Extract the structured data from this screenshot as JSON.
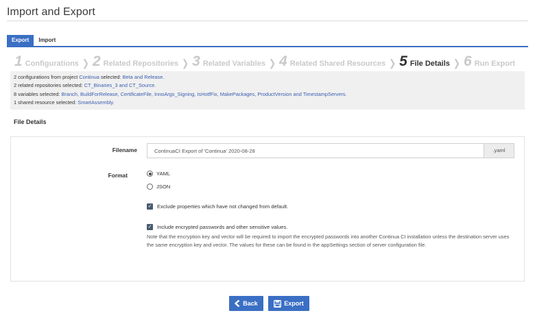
{
  "page": {
    "title": "Import and Export"
  },
  "tabs": [
    {
      "label": "Export",
      "active": true
    },
    {
      "label": "Import",
      "active": false
    }
  ],
  "steps": [
    {
      "num": "1",
      "label": "Configurations"
    },
    {
      "num": "2",
      "label": "Related Repositories"
    },
    {
      "num": "3",
      "label": "Related Variables"
    },
    {
      "num": "4",
      "label": "Related Shared Resources"
    },
    {
      "num": "5",
      "label": "File Details",
      "current": true
    },
    {
      "num": "6",
      "label": "Run Export"
    }
  ],
  "summary": {
    "line1": {
      "a": "2 configurations from project ",
      "project": "Continua",
      "b": " selected: ",
      "items": "Beta and Release."
    },
    "line2": {
      "a": "2 related repositories selected: ",
      "items": "CT_Binaries_3 and CT_Source."
    },
    "line3": {
      "a": "8 variables selected: ",
      "items": "Branch, BuildForRelease, CertificateFile, InnoArgs_Signing, IsHotfFix, MakePackages, ProductVersion and TimestampServers."
    },
    "line4": {
      "a": "1 shared resource selected: ",
      "items": "SmartAssembly."
    }
  },
  "section": {
    "title": "File Details"
  },
  "form": {
    "filename_label": "Filename",
    "filename_value": "ContinuaCI Export of 'Continua' 2020-08-28",
    "filename_ext": ".yaml",
    "format_label": "Format",
    "format_options": [
      "YAML",
      "JSON"
    ],
    "format_selected": "YAML",
    "exclude_label": "Exclude properties which have not changed from default.",
    "include_label": "Include encrypted passwords and other sensitive values.",
    "note": "Note that the encryption key and vector will be required to import the encrypted passwords into another Continua CI installation unless the destination server uses the same encryption key and vector. The values for these can be found in the appSettings section of server configuration file."
  },
  "buttons": {
    "back": "Back",
    "export": "Export"
  },
  "colors": {
    "accent": "#3a6fc4",
    "link": "#3a5fb0",
    "muted_step": "#c9c9c9"
  }
}
